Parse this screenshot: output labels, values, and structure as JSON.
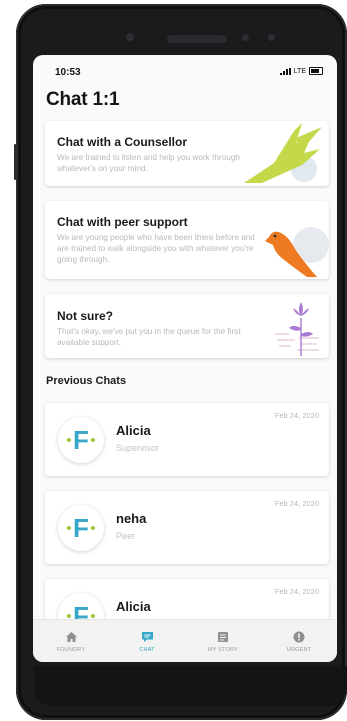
{
  "status_bar": {
    "time": "10:53",
    "network": "LTE"
  },
  "page": {
    "title": "Chat 1:1"
  },
  "options": [
    {
      "title": "Chat with a Counsellor",
      "description": "We are trained to listen and help you work through whatever's on your mind."
    },
    {
      "title": "Chat with peer support",
      "description": "We are young people who have been there before and are trained to walk alongside you with whatever you're going through."
    },
    {
      "title": "Not sure?",
      "description": "That's okay, we've put you in the queue for the first available support."
    }
  ],
  "previous_chats": {
    "title": "Previous Chats",
    "items": [
      {
        "avatar_letter": "F",
        "name": "Alicia",
        "role": "Supervisor",
        "date": "Feb 24, 2020"
      },
      {
        "avatar_letter": "F",
        "name": "neha",
        "role": "Peer",
        "date": "Feb 24, 2020"
      },
      {
        "avatar_letter": "F",
        "name": "Alicia",
        "role": "",
        "date": "Feb 24, 2020"
      }
    ]
  },
  "tabs": [
    {
      "label": "FOUNDRY",
      "icon": "home-icon",
      "active": false
    },
    {
      "label": "CHAT",
      "icon": "chat-icon",
      "active": true
    },
    {
      "label": "MY STORY",
      "icon": "book-icon",
      "active": false
    },
    {
      "label": "URGENT",
      "icon": "alert-icon",
      "active": false
    }
  ],
  "colors": {
    "accent": "#35a9c7",
    "eagle": "#c5d84a",
    "bird": "#ee7a22",
    "plant": "#a77bd1",
    "dot": "#9bc53d"
  }
}
